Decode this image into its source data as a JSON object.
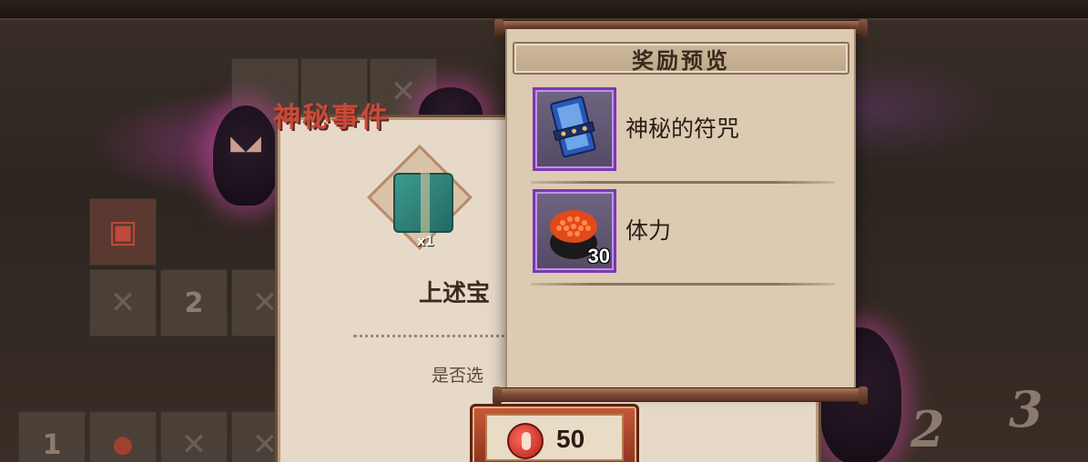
{
  "popup": {
    "title": "奖励预览",
    "rewards": [
      {
        "name": "神秘的符咒",
        "icon": "talisman-icon",
        "count": ""
      },
      {
        "name": "体力",
        "icon": "sushi-stamina-icon",
        "count": "30"
      }
    ]
  },
  "event": {
    "title": "神秘事件",
    "chest_qty": "x1",
    "description": "上述宝",
    "question": "是否选"
  },
  "cost": {
    "icon": "magatama-icon",
    "value": "50"
  },
  "board": {
    "cell_numbers": [
      "2",
      "1"
    ],
    "deco_numbers": [
      "2",
      "3"
    ]
  },
  "colors": {
    "scroll_paper": "#dccab2",
    "item_frame_border": "#7a3ab0",
    "event_title": "#c94a3a",
    "cost_button": "#c55a3a"
  }
}
